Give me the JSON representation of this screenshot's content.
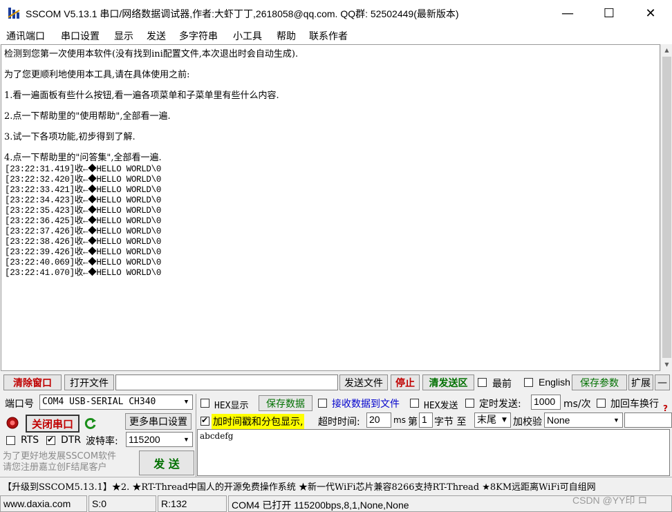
{
  "window": {
    "title": "SSCOM V5.13.1 串口/网络数据调试器,作者:大虾丁丁,2618058@qq.com. QQ群:  52502449(最新版本)",
    "minimize": "—",
    "maximize": "☐",
    "close": "✕"
  },
  "menu": [
    "通讯端口",
    "串口设置",
    "显示",
    "发送",
    "多字符串",
    "小工具",
    "帮助",
    "联系作者"
  ],
  "output": {
    "intro": [
      "检测到您第一次使用本软件(没有找到ini配置文件,本次退出时会自动生成).",
      "为了您更顺利地使用本工具,请在具体使用之前:",
      "1.看一遍面板有些什么按钮,看一遍各项菜单和子菜单里有些什么内容.",
      "2.点一下帮助里的\"使用帮助\",全部看一遍.",
      "3.试一下各项功能,初步得到了解.",
      "4.点一下帮助里的\"问答集\",全部看一遍."
    ],
    "log": [
      "[23:22:31.419]收←◆HELLO WORLD\\0",
      "[23:22:32.420]收←◆HELLO WORLD\\0",
      "[23:22:33.421]收←◆HELLO WORLD\\0",
      "[23:22:34.423]收←◆HELLO WORLD\\0",
      "[23:22:35.423]收←◆HELLO WORLD\\0",
      "[23:22:36.425]收←◆HELLO WORLD\\0",
      "[23:22:37.426]收←◆HELLO WORLD\\0",
      "[23:22:38.426]收←◆HELLO WORLD\\0",
      "[23:22:39.426]收←◆HELLO WORLD\\0",
      "[23:22:40.069]收←◆HELLO WORLD\\0",
      "[23:22:41.070]收←◆HELLO WORLD\\0"
    ]
  },
  "toolbar": {
    "clear_window": "清除窗口",
    "open_file": "打开文件",
    "file_path": "",
    "send_file": "发送文件",
    "stop": "停止",
    "clear_send": "清发送区",
    "topmost": "最前",
    "english": "English",
    "save_params": "保存参数",
    "expand": "扩展",
    "collapse": "—"
  },
  "port": {
    "port_label": "端口号",
    "port_value": "COM4 USB-SERIAL CH340",
    "close_port": "关闭串口",
    "refresh_icon": "refresh-icon",
    "more_settings": "更多串口设置",
    "rts": "RTS",
    "dtr": "DTR",
    "rts_checked": false,
    "dtr_checked": true,
    "baud_label": "波特率:",
    "baud_value": "115200",
    "promo": "为了更好地发展SSCOM软件\n请您注册嘉立创F结尾客户",
    "send_button": "发 送"
  },
  "options": {
    "hex_display": "HEX显示",
    "save_data": "保存数据",
    "recv_to_file": "接收数据到文件",
    "hex_send": "HEX发送",
    "timed_send": "定时发送:",
    "interval": "1000",
    "interval_unit": "ms/次",
    "add_newline": "加回车换行",
    "timestamp": "加时间戳和分包显示,",
    "timeout_label": "超时时间:",
    "timeout_value": "20",
    "timeout_unit": "ms",
    "byte_prefix": "第",
    "byte_from": "1",
    "byte_mid": "字节 至",
    "byte_to": "末尾",
    "checksum_label": "加校验",
    "checksum_value": "None"
  },
  "send_area": {
    "content": "abcdefg"
  },
  "ticker": "【升级到SSCOM5.13.1】★2. ★RT-Thread中国人的开源免费操作系统 ★新一代WiFi芯片兼容8266支持RT-Thread ★8KM远距离WiFi可自组网",
  "status": {
    "website": "www.daxia.com",
    "sent": "S:0",
    "received": "R:132",
    "port_status": "COM4 已打开  115200bps,8,1,None,None",
    "watermark": "CSDN @YY印 ロ"
  },
  "colors": {
    "accent_red": "#c00000",
    "accent_green": "#007000",
    "highlight_yellow": "#ffff00",
    "recv_blue": "#0000cc"
  }
}
